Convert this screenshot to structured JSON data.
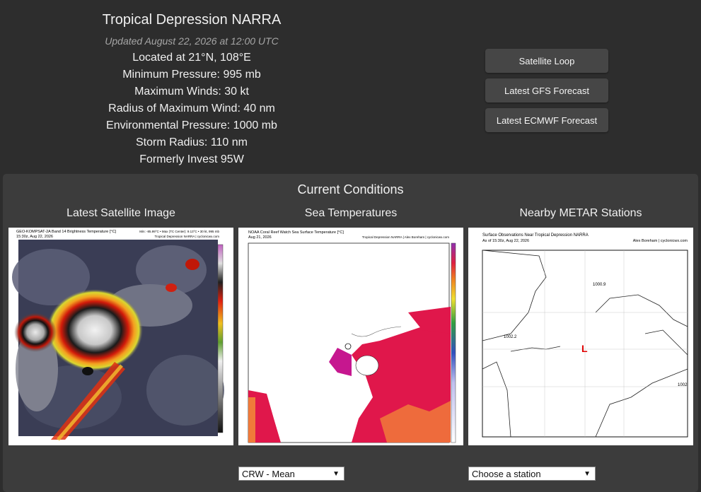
{
  "storm": {
    "title": "Tropical Depression NARRA",
    "updated": "Updated August 22, 2026 at 12:00 UTC",
    "location": "Located at 21°N, 108°E",
    "min_pressure": "Minimum Pressure: 995 mb",
    "max_winds": "Maximum Winds: 30 kt",
    "rmw": "Radius of Maximum Wind: 40 nm",
    "env_pressure": "Environmental Pressure: 1000 mb",
    "storm_radius": "Storm Radius: 110 nm",
    "formerly": "Formerly Invest 95W"
  },
  "buttons": {
    "satellite_loop": "Satellite Loop",
    "gfs": "Latest GFS Forecast",
    "ecmwf": "Latest ECMWF Forecast"
  },
  "conditions": {
    "title": "Current Conditions",
    "satellite": {
      "heading": "Latest Satellite Image",
      "caption_left": "GEO-KOMPSAT-2A Band 14 Brightness Temperature [°C]",
      "caption_time": "15:30z, Aug 22, 2026",
      "caption_right": "Min: -85.99°C • Max (TC Center): 9.13°C • 30 kt, 995 mb",
      "caption_right2": "Tropical Depression NARRA | cyclonicwx.com"
    },
    "sst": {
      "heading": "Sea Temperatures",
      "caption_left": "NOAA Coral Reef Watch Sea Surface Temperature [°C]",
      "caption_time": "Aug 21, 2026",
      "caption_right": "Tropical Depression NARRA | Alex Boreham | cyclonicwx.com",
      "select_value": "CRW - Mean"
    },
    "metar": {
      "heading": "Nearby METAR Stations",
      "caption_title": "Surface Observations Near Tropical Depression NARRA",
      "caption_time": "As of 15:30z, Aug 22, 2026",
      "caption_right": "Alex Boreham | cyclonicwx.com",
      "obs1": "1000.9",
      "obs2": "1002.2",
      "obs3": "1002",
      "low_marker": "L",
      "select_value": "Choose a station"
    }
  },
  "colors": {
    "background": "#2d2d2d",
    "panel": "#3c3c3c",
    "button": "#464646",
    "low_marker": "#e00000"
  }
}
